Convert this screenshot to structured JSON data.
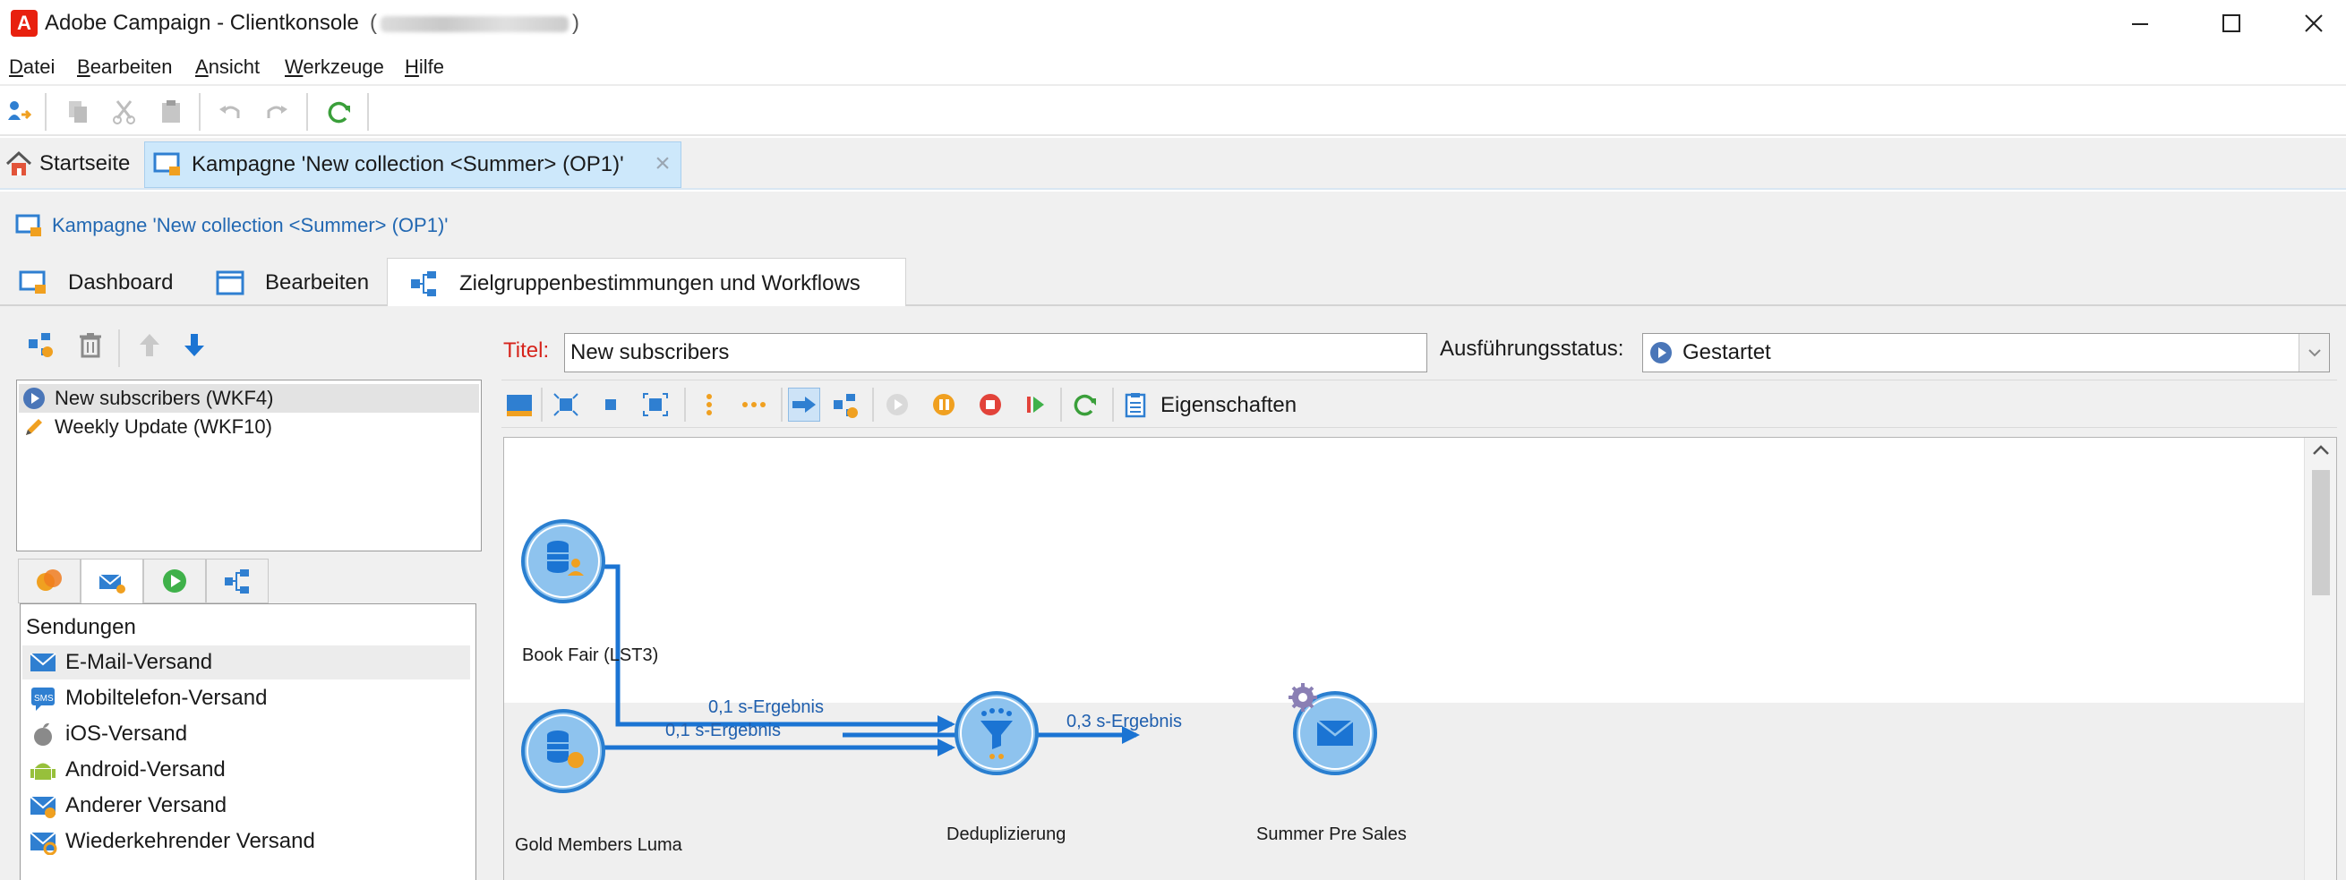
{
  "window": {
    "title": "Adobe Campaign - Clientkonsole",
    "user_prefix": "(",
    "user_suffix": ")"
  },
  "menu": {
    "items": [
      {
        "underline": "D",
        "rest": "atei"
      },
      {
        "underline": "B",
        "rest": "earbeiten"
      },
      {
        "underline": "A",
        "rest": "nsicht"
      },
      {
        "underline": "W",
        "rest": "erkzeuge"
      },
      {
        "underline": "H",
        "rest": "ilfe"
      }
    ]
  },
  "tabs": {
    "home": "Startseite",
    "campaign": "Kampagne 'New collection <Summer> (OP1)'"
  },
  "breadcrumb": "Kampagne 'New collection <Summer> (OP1)'",
  "inner_tabs": {
    "dashboard": "Dashboard",
    "edit": "Bearbeiten",
    "workflows": "Zielgruppenbestimmungen und Workflows"
  },
  "workflows": [
    {
      "label": "New subscribers (WKF4)",
      "icon": "play-circle-icon"
    },
    {
      "label": "Weekly Update (WKF10)",
      "icon": "pencil-icon"
    }
  ],
  "palette": {
    "header": "Sendungen",
    "items": [
      {
        "label": "E-Mail-Versand",
        "icon": "email-delivery-icon"
      },
      {
        "label": "Mobiltelefon-Versand",
        "icon": "sms-icon"
      },
      {
        "label": "iOS-Versand",
        "icon": "apple-icon"
      },
      {
        "label": "Android-Versand",
        "icon": "android-icon"
      },
      {
        "label": "Anderer Versand",
        "icon": "other-delivery-icon"
      },
      {
        "label": "Wiederkehrender Versand",
        "icon": "recurring-delivery-icon"
      }
    ]
  },
  "form": {
    "title_label": "Titel:",
    "title_value": "New subscribers",
    "status_label": "Ausführungsstatus:",
    "status_value": "Gestartet"
  },
  "workflow_toolbar": {
    "properties_label": "Eigenschaften"
  },
  "diagram": {
    "nodes": [
      {
        "label": "Book Fair (LST3)"
      },
      {
        "label": "Gold Members Luma"
      },
      {
        "label": "Deduplizierung"
      },
      {
        "label": "Summer Pre Sales"
      }
    ],
    "edges": [
      {
        "label": "0,1 s-Ergebnis"
      },
      {
        "label": "0,1 s-Ergebnis"
      },
      {
        "label": "0,3 s-Ergebnis"
      }
    ]
  },
  "colors": {
    "accent": "#1b74d3",
    "node_fill": "#8ec3ee",
    "node_border": "#2a7fd0",
    "title_label": "#d6241c",
    "adobe_red": "#e8200e"
  }
}
